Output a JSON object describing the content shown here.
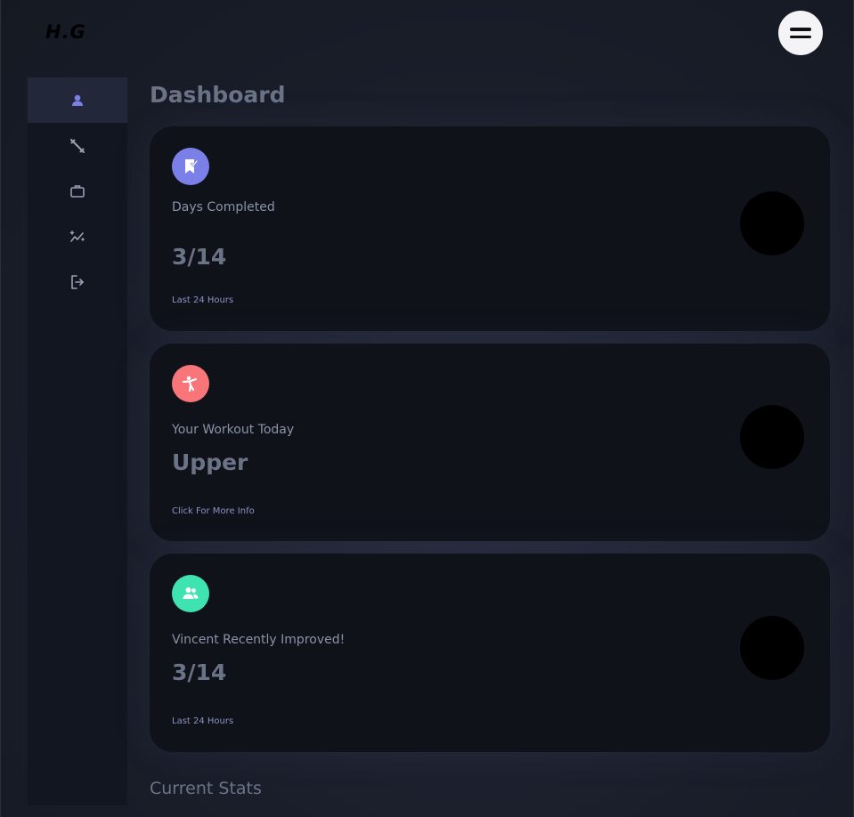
{
  "header": {
    "logo": "H.G",
    "menu_icon": "hamburger-icon"
  },
  "sidebar": {
    "items": [
      {
        "icon": "user-icon",
        "active": true
      },
      {
        "icon": "dumbbell-icon",
        "active": false
      },
      {
        "icon": "briefcase-icon",
        "active": false
      },
      {
        "icon": "trend-sparkle-icon",
        "active": false
      },
      {
        "icon": "logout-icon",
        "active": false
      }
    ]
  },
  "main": {
    "title": "Dashboard",
    "cards": [
      {
        "icon": "bookmark-check-icon",
        "icon_color": "#7b7fe8",
        "label": "Days Completed",
        "value": "3/14",
        "footer": "Last 24 Hours"
      },
      {
        "icon": "martial-arts-icon",
        "icon_color": "#f8767a",
        "label": "Your Workout Today",
        "value": "Upper",
        "footer": "Click For More Info"
      },
      {
        "icon": "users-icon",
        "icon_color": "#3fe3b0",
        "label": "Vincent Recently Improved!",
        "value": "3/14",
        "footer": "Last 24 Hours"
      }
    ],
    "section_title": "Current Stats"
  }
}
